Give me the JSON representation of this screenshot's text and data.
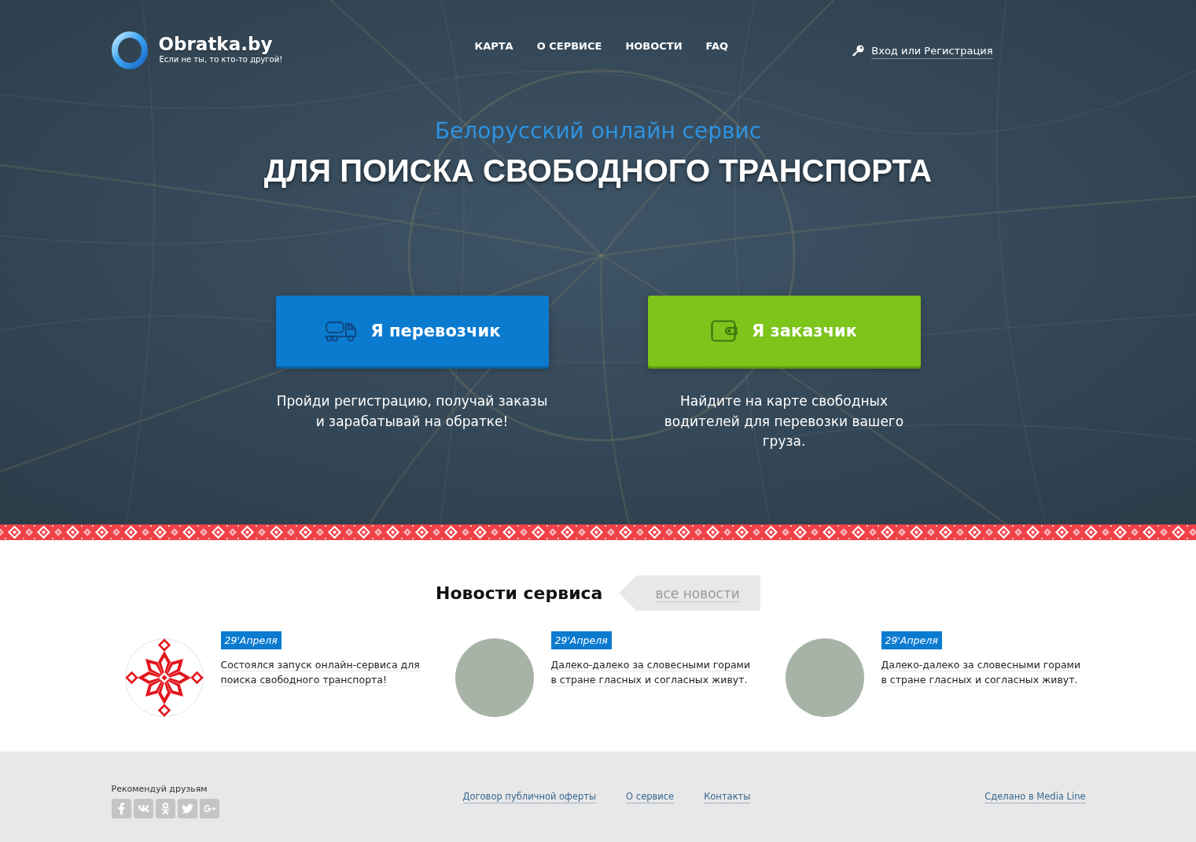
{
  "header": {
    "logo": {
      "name": "Obratka.by",
      "tagline": "Если не ты, то кто-то другой!"
    },
    "nav": [
      "КАРТА",
      "О СЕРВИСЕ",
      "НОВОСТИ",
      "FAQ"
    ],
    "login": {
      "label": "Вход или Регистрация"
    }
  },
  "hero": {
    "subtitle": "Белорусский онлайн сервис",
    "title": "ДЛЯ ПОИСКА СВОБОДНОГО ТРАНСПОРТА",
    "roles": [
      {
        "kind": "carrier",
        "label": "Я перевозчик",
        "description": "Пройди регистрацию, получай заказы и зарабатывай на обратке!"
      },
      {
        "kind": "customer",
        "label": "Я заказчик",
        "description": "Найдите на карте свободных водителей для перевозки вашего груза."
      }
    ]
  },
  "news": {
    "title": "Новости сервиса",
    "all_link": "все новости",
    "items": [
      {
        "kind": "ornament",
        "date": "29'Апреля",
        "text": "Состоялся запуск онлайн-сервиса для поиска свободного транспорта!"
      },
      {
        "kind": "photo",
        "date": "29'Апреля",
        "text": "Далеко-далеко за словесными горами в стране гласных и согласных живут."
      },
      {
        "kind": "photo",
        "date": "29'Апреля",
        "text": "Далеко-далеко за словесными горами в стране гласных и согласных живут."
      }
    ]
  },
  "footer": {
    "share_label": "Рекомендуй друзьям",
    "social": [
      {
        "kind": "facebook"
      },
      {
        "kind": "vk"
      },
      {
        "kind": "odnoklassniki"
      },
      {
        "kind": "twitter"
      },
      {
        "kind": "google_plus"
      }
    ],
    "links": [
      "Договор публичной оферты",
      "О сервисе",
      "Контакты"
    ],
    "credit": "Сделано в Media Line"
  }
}
